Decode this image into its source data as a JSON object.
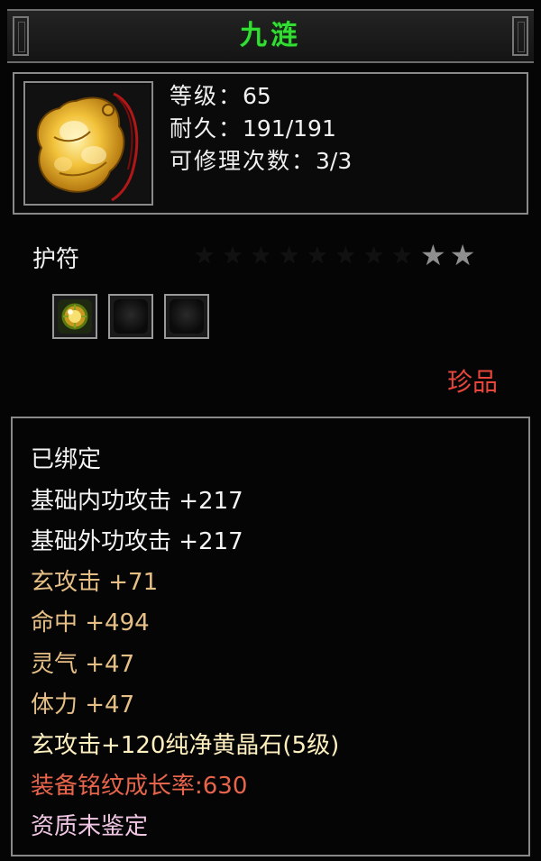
{
  "title": "九涟",
  "header": {
    "icon": "amulet-icon",
    "level_label": "等级：",
    "level_value": "65",
    "durability_label": "耐久：",
    "durability_value": "191/191",
    "repair_label": "可修理次数：",
    "repair_value": "3/3"
  },
  "item_type": "护符",
  "stars": {
    "lit": 2,
    "total": 10
  },
  "slots": [
    {
      "state": "filled",
      "icon": "gem-icon"
    },
    {
      "state": "empty"
    },
    {
      "state": "empty"
    }
  ],
  "rarity": "珍品",
  "attributes": [
    {
      "text": "已绑定",
      "color": "#f4f4f4"
    },
    {
      "text": "基础内功攻击  +217",
      "color": "#f4f4f4"
    },
    {
      "text": "基础外功攻击  +217",
      "color": "#f4f4f4"
    },
    {
      "text": "玄攻击  +71",
      "color": "#e6bf86"
    },
    {
      "text": "命中  +494",
      "color": "#e6bf86"
    },
    {
      "text": "灵气  +47",
      "color": "#e6bf86"
    },
    {
      "text": "体力  +47",
      "color": "#e6bf86"
    },
    {
      "text": "玄攻击+120纯净黄晶石(5级)",
      "color": "#fff0c0"
    },
    {
      "text": "装备铭纹成长率:630",
      "color": "#e8654c"
    },
    {
      "text": "资质未鉴定",
      "color": "#f0c6e4"
    }
  ]
}
